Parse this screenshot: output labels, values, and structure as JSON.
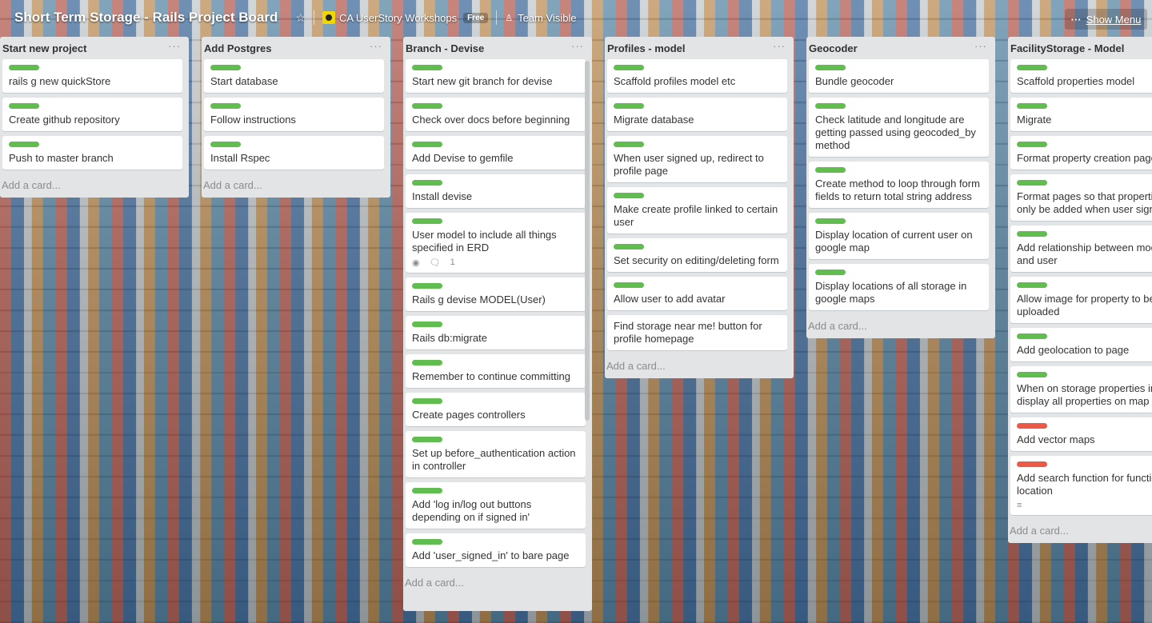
{
  "header": {
    "title": "Short Term Storage - Rails Project Board",
    "team": "CA UserStory Workshops",
    "team_badge": "Free",
    "visibility": "Team Visible",
    "menu_label": "Show Menu"
  },
  "colors": {
    "green_label": "#61bd4f",
    "red_label": "#eb5a46",
    "list_bg": "#e2e4e6"
  },
  "add_card": "Add a card...",
  "lists": [
    {
      "title": "Start new project",
      "cards": [
        {
          "label": "green",
          "text": "rails g new quickStore"
        },
        {
          "label": "green",
          "text": "Create github repository"
        },
        {
          "label": "green",
          "text": "Push to master branch"
        }
      ]
    },
    {
      "title": "Add Postgres",
      "cards": [
        {
          "label": "green",
          "text": "Start database"
        },
        {
          "label": "green",
          "text": "Follow instructions"
        },
        {
          "label": "green",
          "text": "Install Rspec"
        }
      ]
    },
    {
      "title": "Branch - Devise",
      "cards": [
        {
          "label": "green",
          "text": "Start new git branch for devise"
        },
        {
          "label": "green",
          "text": "Check over docs before beginning"
        },
        {
          "label": "green",
          "text": "Add Devise to gemfile"
        },
        {
          "label": "green",
          "text": "Install devise"
        },
        {
          "label": "green",
          "text": "User model to include all things specified in ERD",
          "comments": "1"
        },
        {
          "label": "green",
          "text": "Rails g devise MODEL(User)"
        },
        {
          "label": "green",
          "text": "Rails db:migrate"
        },
        {
          "label": "green",
          "text": "Remember to continue committing"
        },
        {
          "label": "green",
          "text": "Create pages controllers"
        },
        {
          "label": "green",
          "text": "Set up before_authentication action in controller"
        },
        {
          "label": "green",
          "text": "Add 'log in/log out buttons depending on if signed in'"
        },
        {
          "label": "green",
          "text": "Add 'user_signed_in' to bare page"
        }
      ]
    },
    {
      "title": "Profiles - model",
      "cards": [
        {
          "label": "green",
          "text": "Scaffold profiles model etc"
        },
        {
          "label": "green",
          "text": "Migrate database"
        },
        {
          "label": "green",
          "text": "When user signed up, redirect to profile page"
        },
        {
          "label": "green",
          "text": "Make create profile linked to certain user"
        },
        {
          "label": "green",
          "text": "Set security on editing/deleting form"
        },
        {
          "label": "green",
          "text": "Allow user to add avatar"
        },
        {
          "label": "none",
          "text": "Find storage near me! button for profile homepage"
        }
      ]
    },
    {
      "title": "Geocoder",
      "cards": [
        {
          "label": "green",
          "text": "Bundle geocoder"
        },
        {
          "label": "green",
          "text": "Check latitude and longitude are getting passed using geocoded_by method"
        },
        {
          "label": "green",
          "text": "Create method to loop through form fields to return total string address"
        },
        {
          "label": "green",
          "text": "Display location of current user on google map"
        },
        {
          "label": "green",
          "text": "Display locations of all storage in google maps"
        }
      ]
    },
    {
      "title": "FacilityStorage - Model",
      "cards": [
        {
          "label": "green",
          "text": "Scaffold properties model"
        },
        {
          "label": "green",
          "text": "Migrate"
        },
        {
          "label": "green",
          "text": "Format property creation page"
        },
        {
          "label": "green",
          "text": "Format pages so that properties can only be added when user signed in"
        },
        {
          "label": "green",
          "text": "Add relationship between models and user"
        },
        {
          "label": "green",
          "text": "Allow image for property to be uploaded"
        },
        {
          "label": "green",
          "text": "Add geolocation to page"
        },
        {
          "label": "green",
          "text": "When on storage properties index display all properties on map"
        },
        {
          "label": "red",
          "text": "Add vector maps"
        },
        {
          "label": "red",
          "text": "Add search function for function location",
          "description": true
        }
      ]
    }
  ]
}
